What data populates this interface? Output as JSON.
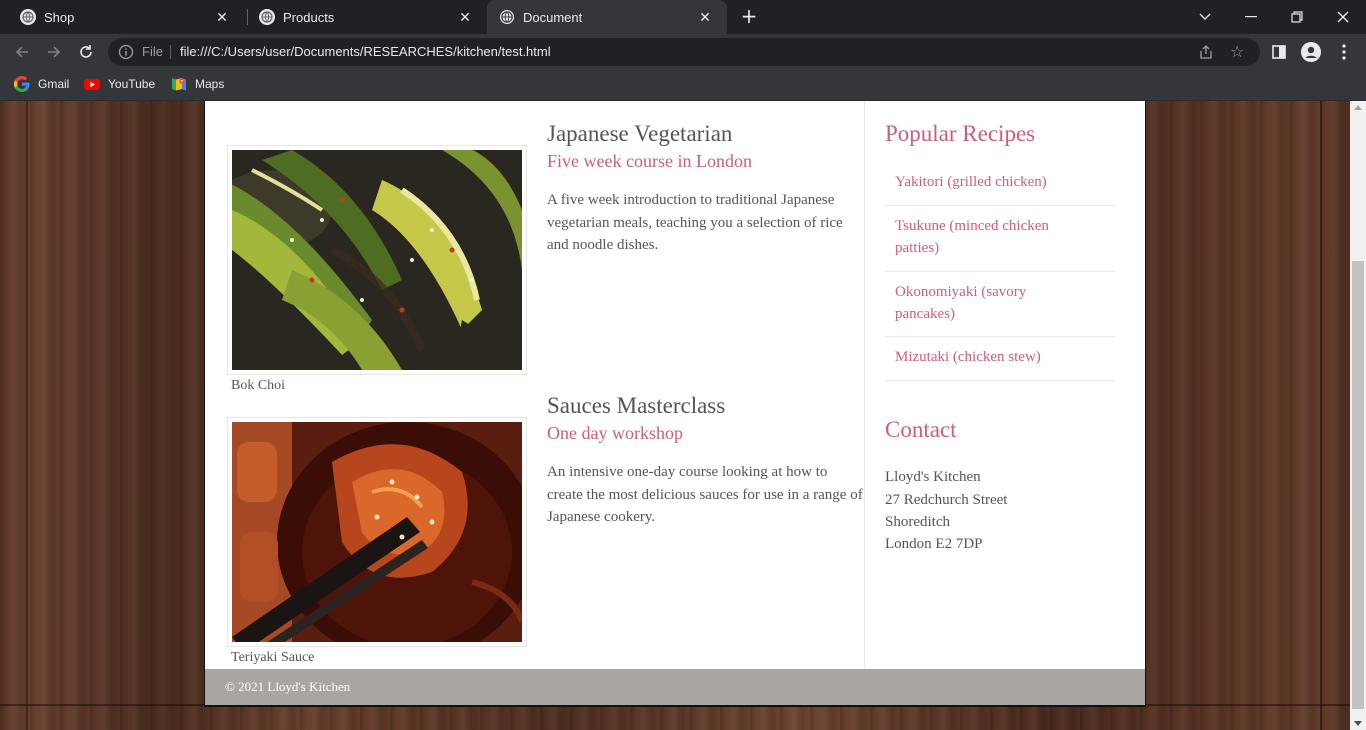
{
  "browser": {
    "tabs": [
      {
        "title": "Shop",
        "active": false
      },
      {
        "title": "Products",
        "active": false
      },
      {
        "title": "Document",
        "active": true
      }
    ],
    "address": {
      "scheme_label": "File",
      "url": "file:///C:/Users/user/Documents/RESEARCHES/kitchen/test.html"
    },
    "bookmarks": [
      {
        "label": "Gmail",
        "icon": "google-icon"
      },
      {
        "label": "YouTube",
        "icon": "youtube-icon"
      },
      {
        "label": "Maps",
        "icon": "maps-icon"
      }
    ]
  },
  "page": {
    "courses": [
      {
        "image_caption": "Bok Choi",
        "title": "Japanese Vegetarian",
        "subtitle": "Five week course in London",
        "description": "A five week introduction to traditional Japanese vegetarian meals, teaching you a selection of rice and noodle dishes."
      },
      {
        "image_caption": "Teriyaki Sauce",
        "title": "Sauces Masterclass",
        "subtitle": "One day workshop",
        "description": "An intensive one-day course looking at how to create the most delicious sauces for use in a range of Japanese cookery."
      }
    ],
    "sidebar": {
      "popular_title": "Popular Recipes",
      "recipes": [
        {
          "line1": "Yakitori (grilled chicken)",
          "line2": ""
        },
        {
          "line1": "Tsukune (minced chicken",
          "line2": "patties)"
        },
        {
          "line1": "Okonomiyaki (savory",
          "line2": "pancakes)"
        },
        {
          "line1": "Mizutaki (chicken stew)",
          "line2": ""
        }
      ],
      "contact_title": "Contact",
      "contact_lines": [
        "Lloyd's Kitchen",
        "27 Redchurch Street",
        "Shoreditch",
        "London E2 7DP"
      ]
    },
    "footer": "© 2021 Lloyd's Kitchen"
  },
  "colors": {
    "accent": "#c9607a",
    "body_text": "#555555",
    "footer_bg": "#a9a6a2"
  }
}
